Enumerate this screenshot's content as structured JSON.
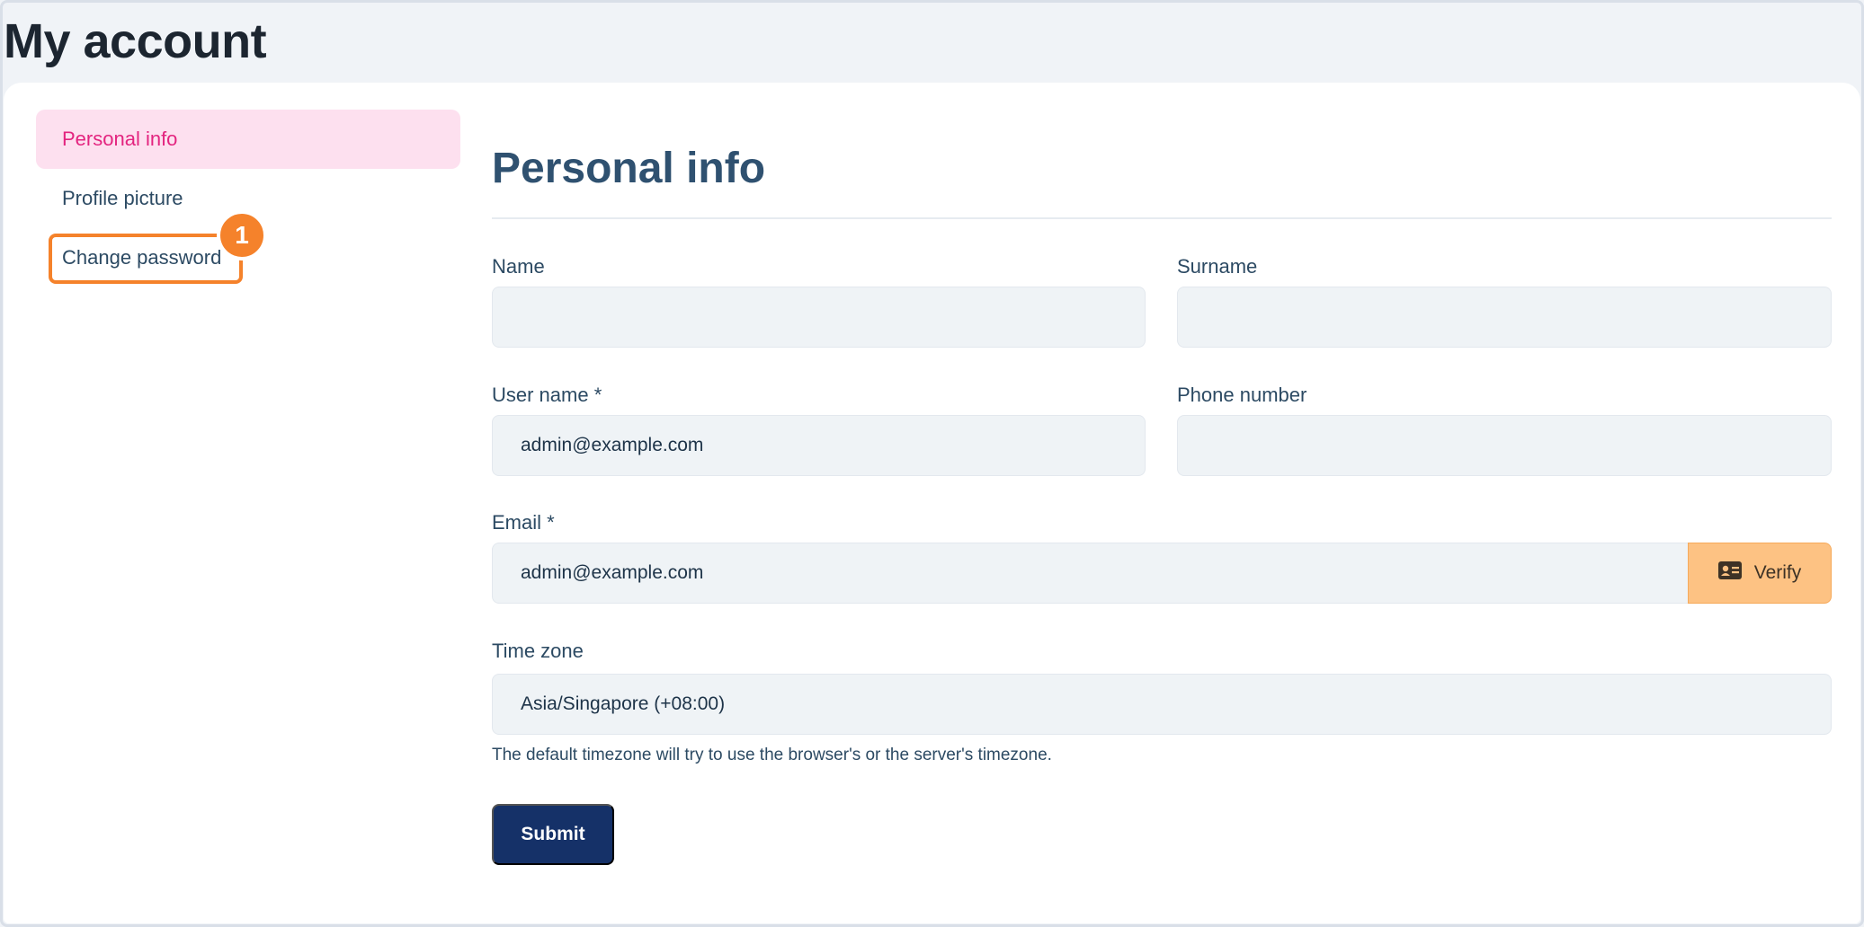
{
  "header": {
    "title": "My account"
  },
  "sidebar": {
    "items": [
      {
        "label": "Personal info",
        "active": true
      },
      {
        "label": "Profile picture",
        "active": false
      },
      {
        "label": "Change password",
        "active": false
      }
    ],
    "step_badge": "1"
  },
  "form": {
    "title": "Personal info",
    "name": {
      "label": "Name",
      "value": ""
    },
    "surname": {
      "label": "Surname",
      "value": ""
    },
    "username": {
      "label": "User name *",
      "value": "admin@example.com"
    },
    "phone": {
      "label": "Phone number",
      "value": ""
    },
    "email": {
      "label": "Email *",
      "value": "admin@example.com",
      "verify_label": "Verify",
      "verify_icon": "id-card-icon"
    },
    "timezone": {
      "label": "Time zone",
      "value": "Asia/Singapore (+08:00)",
      "help": "The default timezone will try to use the browser's or the server's timezone."
    },
    "submit_label": "Submit"
  },
  "colors": {
    "accent_pink": "#e3247f",
    "active_bg": "#fde0ef",
    "highlight_orange": "#f5822b",
    "verify_bg": "#fdc283",
    "submit_bg": "#153168"
  }
}
